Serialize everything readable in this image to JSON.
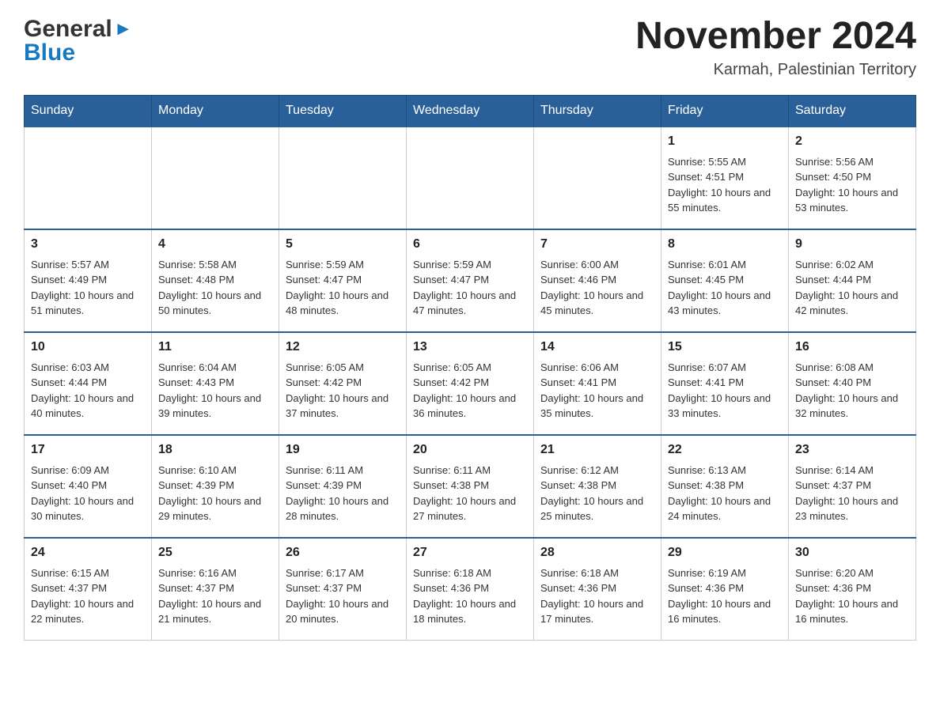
{
  "header": {
    "logo_general": "General",
    "logo_blue": "Blue",
    "title": "November 2024",
    "location": "Karmah, Palestinian Territory"
  },
  "days_of_week": [
    "Sunday",
    "Monday",
    "Tuesday",
    "Wednesday",
    "Thursday",
    "Friday",
    "Saturday"
  ],
  "weeks": [
    {
      "days": [
        {
          "number": "",
          "info": ""
        },
        {
          "number": "",
          "info": ""
        },
        {
          "number": "",
          "info": ""
        },
        {
          "number": "",
          "info": ""
        },
        {
          "number": "",
          "info": ""
        },
        {
          "number": "1",
          "info": "Sunrise: 5:55 AM\nSunset: 4:51 PM\nDaylight: 10 hours and 55 minutes."
        },
        {
          "number": "2",
          "info": "Sunrise: 5:56 AM\nSunset: 4:50 PM\nDaylight: 10 hours and 53 minutes."
        }
      ]
    },
    {
      "days": [
        {
          "number": "3",
          "info": "Sunrise: 5:57 AM\nSunset: 4:49 PM\nDaylight: 10 hours and 51 minutes."
        },
        {
          "number": "4",
          "info": "Sunrise: 5:58 AM\nSunset: 4:48 PM\nDaylight: 10 hours and 50 minutes."
        },
        {
          "number": "5",
          "info": "Sunrise: 5:59 AM\nSunset: 4:47 PM\nDaylight: 10 hours and 48 minutes."
        },
        {
          "number": "6",
          "info": "Sunrise: 5:59 AM\nSunset: 4:47 PM\nDaylight: 10 hours and 47 minutes."
        },
        {
          "number": "7",
          "info": "Sunrise: 6:00 AM\nSunset: 4:46 PM\nDaylight: 10 hours and 45 minutes."
        },
        {
          "number": "8",
          "info": "Sunrise: 6:01 AM\nSunset: 4:45 PM\nDaylight: 10 hours and 43 minutes."
        },
        {
          "number": "9",
          "info": "Sunrise: 6:02 AM\nSunset: 4:44 PM\nDaylight: 10 hours and 42 minutes."
        }
      ]
    },
    {
      "days": [
        {
          "number": "10",
          "info": "Sunrise: 6:03 AM\nSunset: 4:44 PM\nDaylight: 10 hours and 40 minutes."
        },
        {
          "number": "11",
          "info": "Sunrise: 6:04 AM\nSunset: 4:43 PM\nDaylight: 10 hours and 39 minutes."
        },
        {
          "number": "12",
          "info": "Sunrise: 6:05 AM\nSunset: 4:42 PM\nDaylight: 10 hours and 37 minutes."
        },
        {
          "number": "13",
          "info": "Sunrise: 6:05 AM\nSunset: 4:42 PM\nDaylight: 10 hours and 36 minutes."
        },
        {
          "number": "14",
          "info": "Sunrise: 6:06 AM\nSunset: 4:41 PM\nDaylight: 10 hours and 35 minutes."
        },
        {
          "number": "15",
          "info": "Sunrise: 6:07 AM\nSunset: 4:41 PM\nDaylight: 10 hours and 33 minutes."
        },
        {
          "number": "16",
          "info": "Sunrise: 6:08 AM\nSunset: 4:40 PM\nDaylight: 10 hours and 32 minutes."
        }
      ]
    },
    {
      "days": [
        {
          "number": "17",
          "info": "Sunrise: 6:09 AM\nSunset: 4:40 PM\nDaylight: 10 hours and 30 minutes."
        },
        {
          "number": "18",
          "info": "Sunrise: 6:10 AM\nSunset: 4:39 PM\nDaylight: 10 hours and 29 minutes."
        },
        {
          "number": "19",
          "info": "Sunrise: 6:11 AM\nSunset: 4:39 PM\nDaylight: 10 hours and 28 minutes."
        },
        {
          "number": "20",
          "info": "Sunrise: 6:11 AM\nSunset: 4:38 PM\nDaylight: 10 hours and 27 minutes."
        },
        {
          "number": "21",
          "info": "Sunrise: 6:12 AM\nSunset: 4:38 PM\nDaylight: 10 hours and 25 minutes."
        },
        {
          "number": "22",
          "info": "Sunrise: 6:13 AM\nSunset: 4:38 PM\nDaylight: 10 hours and 24 minutes."
        },
        {
          "number": "23",
          "info": "Sunrise: 6:14 AM\nSunset: 4:37 PM\nDaylight: 10 hours and 23 minutes."
        }
      ]
    },
    {
      "days": [
        {
          "number": "24",
          "info": "Sunrise: 6:15 AM\nSunset: 4:37 PM\nDaylight: 10 hours and 22 minutes."
        },
        {
          "number": "25",
          "info": "Sunrise: 6:16 AM\nSunset: 4:37 PM\nDaylight: 10 hours and 21 minutes."
        },
        {
          "number": "26",
          "info": "Sunrise: 6:17 AM\nSunset: 4:37 PM\nDaylight: 10 hours and 20 minutes."
        },
        {
          "number": "27",
          "info": "Sunrise: 6:18 AM\nSunset: 4:36 PM\nDaylight: 10 hours and 18 minutes."
        },
        {
          "number": "28",
          "info": "Sunrise: 6:18 AM\nSunset: 4:36 PM\nDaylight: 10 hours and 17 minutes."
        },
        {
          "number": "29",
          "info": "Sunrise: 6:19 AM\nSunset: 4:36 PM\nDaylight: 10 hours and 16 minutes."
        },
        {
          "number": "30",
          "info": "Sunrise: 6:20 AM\nSunset: 4:36 PM\nDaylight: 10 hours and 16 minutes."
        }
      ]
    }
  ]
}
